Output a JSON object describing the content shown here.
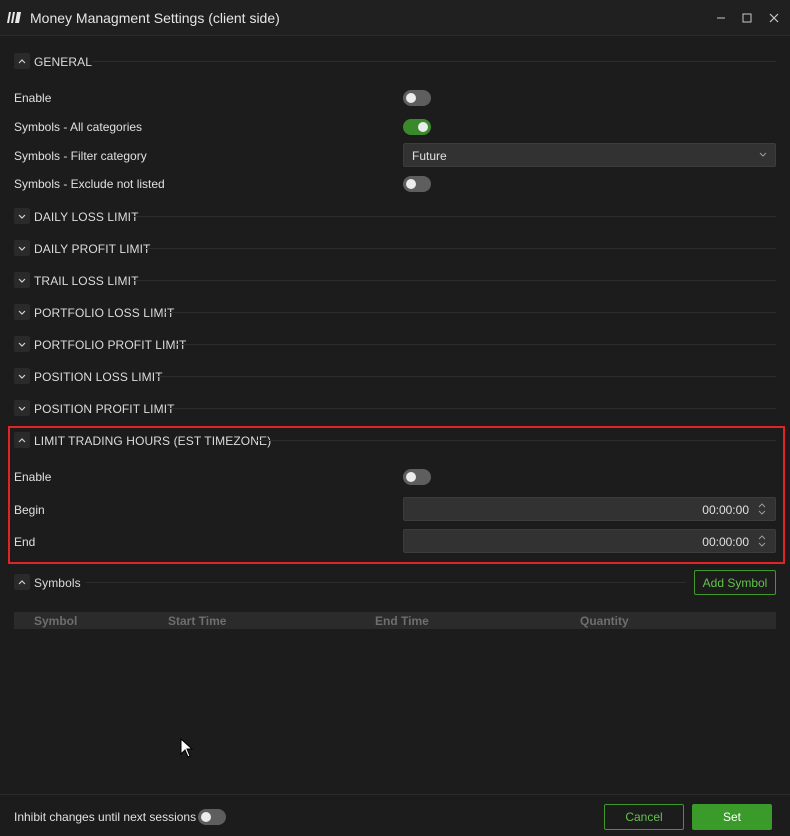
{
  "window": {
    "title": "Money Managment Settings (client side)",
    "logo_icon": "app-logo-icon",
    "controls": [
      "minimize-icon",
      "maximize-icon",
      "close-icon"
    ]
  },
  "general": {
    "title": "GENERAL",
    "expanded": true,
    "rows": {
      "enable": {
        "label": "Enable",
        "on": false
      },
      "all_categories": {
        "label": "Symbols - All categories",
        "on": true
      },
      "filter_category": {
        "label": "Symbols - Filter category",
        "value": "Future"
      },
      "exclude_not_listed": {
        "label": "Symbols - Exclude not listed",
        "on": false
      }
    }
  },
  "collapsed_sections": [
    {
      "title": "DAILY LOSS LIMIT"
    },
    {
      "title": "DAILY PROFIT LIMIT"
    },
    {
      "title": "TRAIL LOSS LIMIT"
    },
    {
      "title": "PORTFOLIO LOSS LIMIT"
    },
    {
      "title": "PORTFOLIO PROFIT LIMIT"
    },
    {
      "title": "POSITION LOSS LIMIT"
    },
    {
      "title": "POSITION PROFIT LIMIT"
    }
  ],
  "trading_hours": {
    "title": "LIMIT TRADING HOURS (EST TIMEZONE)",
    "expanded": true,
    "enable": {
      "label": "Enable",
      "on": false
    },
    "begin": {
      "label": "Begin",
      "value": "00:00:00"
    },
    "end": {
      "label": "End",
      "value": "00:00:00"
    }
  },
  "symbols": {
    "title": "Symbols",
    "add_button": "Add Symbol",
    "columns": [
      "Symbol",
      "Start Time",
      "End Time",
      "Quantity"
    ]
  },
  "footer": {
    "inhibit_label": "Inhibit changes until next sessions",
    "inhibit_on": false,
    "cancel": "Cancel",
    "set": "Set"
  },
  "colors": {
    "accent_green": "#3a9a2a",
    "highlight_red": "#e02424",
    "background": "#1c1c1c"
  }
}
